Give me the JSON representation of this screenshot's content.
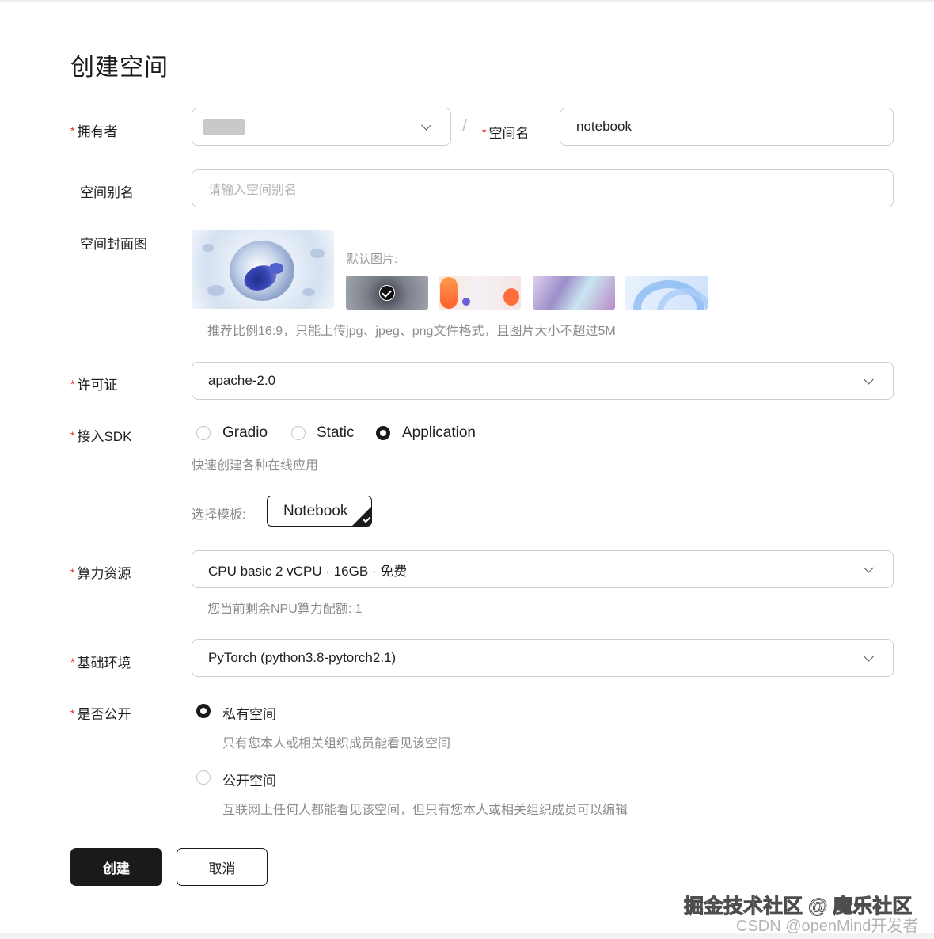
{
  "page": {
    "title": "创建空间"
  },
  "owner": {
    "label": "拥有者",
    "required_mark": "*",
    "value": ""
  },
  "separator": "/",
  "space_name": {
    "label": "空间名",
    "required_mark": "*",
    "value": "notebook"
  },
  "alias": {
    "label": "空间别名",
    "placeholder": "请输入空间别名"
  },
  "cover": {
    "label": "空间封面图",
    "default_label": "默认图片:",
    "hint": "推荐比例16:9，只能上传jpg、jpeg、png文件格式，且图片大小不超过5M",
    "default_images": [
      "default-image-dark",
      "default-image-orange",
      "default-image-purple",
      "default-image-blue"
    ],
    "selected_index": 0
  },
  "license": {
    "label": "许可证",
    "required_mark": "*",
    "value": "apache-2.0"
  },
  "sdk": {
    "label": "接入SDK",
    "required_mark": "*",
    "options": [
      "Gradio",
      "Static",
      "Application"
    ],
    "selected": "Application",
    "hint": "快速创建各种在线应用",
    "template_label": "选择模板:",
    "template_value": "Notebook"
  },
  "compute": {
    "label": "算力资源",
    "required_mark": "*",
    "value": "CPU basic 2 vCPU · 16GB · 免费",
    "hint": "您当前剩余NPU算力配额: 1"
  },
  "environment": {
    "label": "基础环境",
    "required_mark": "*",
    "value": "PyTorch (python3.8-pytorch2.1)"
  },
  "visibility": {
    "label": "是否公开",
    "required_mark": "*",
    "private_label": "私有空间",
    "private_hint": "只有您本人或相关组织成员能看见该空间",
    "public_label": "公开空间",
    "public_hint": "互联网上任何人都能看见该空间，但只有您本人或相关组织成员可以编辑",
    "selected": "private"
  },
  "actions": {
    "create": "创建",
    "cancel": "取消"
  },
  "watermark": {
    "line1": "掘金技术社区 @ 魔乐社区",
    "line2": "CSDN @openMind开发者"
  },
  "colors": {
    "primary": "#1a1a1a",
    "required": "#e5252a",
    "hint": "#8c8c8c",
    "border": "#cfcfcf"
  }
}
